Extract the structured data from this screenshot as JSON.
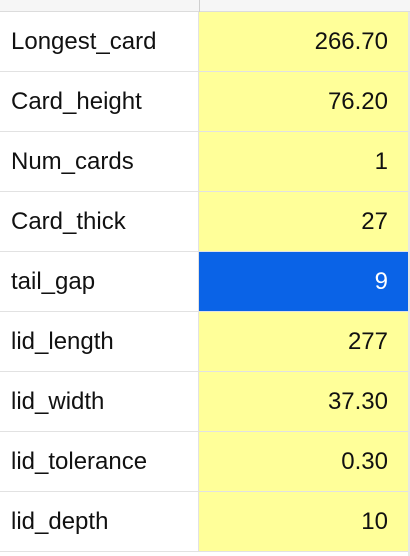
{
  "colors": {
    "value_fill": "#ffff99",
    "selected_fill": "#0a63e7",
    "selected_text": "#ffffff"
  },
  "rows": [
    {
      "label": "Longest_card",
      "value": "266.70"
    },
    {
      "label": "Card_height",
      "value": "76.20"
    },
    {
      "label": "Num_cards",
      "value": "1"
    },
    {
      "label": "Card_thick",
      "value": "27"
    },
    {
      "label": "tail_gap",
      "value": "9"
    },
    {
      "label": "lid_length",
      "value": "277"
    },
    {
      "label": "lid_width",
      "value": "37.30"
    },
    {
      "label": "lid_tolerance",
      "value": "0.30"
    },
    {
      "label": "lid_depth",
      "value": "10"
    }
  ],
  "selected_row": 4
}
